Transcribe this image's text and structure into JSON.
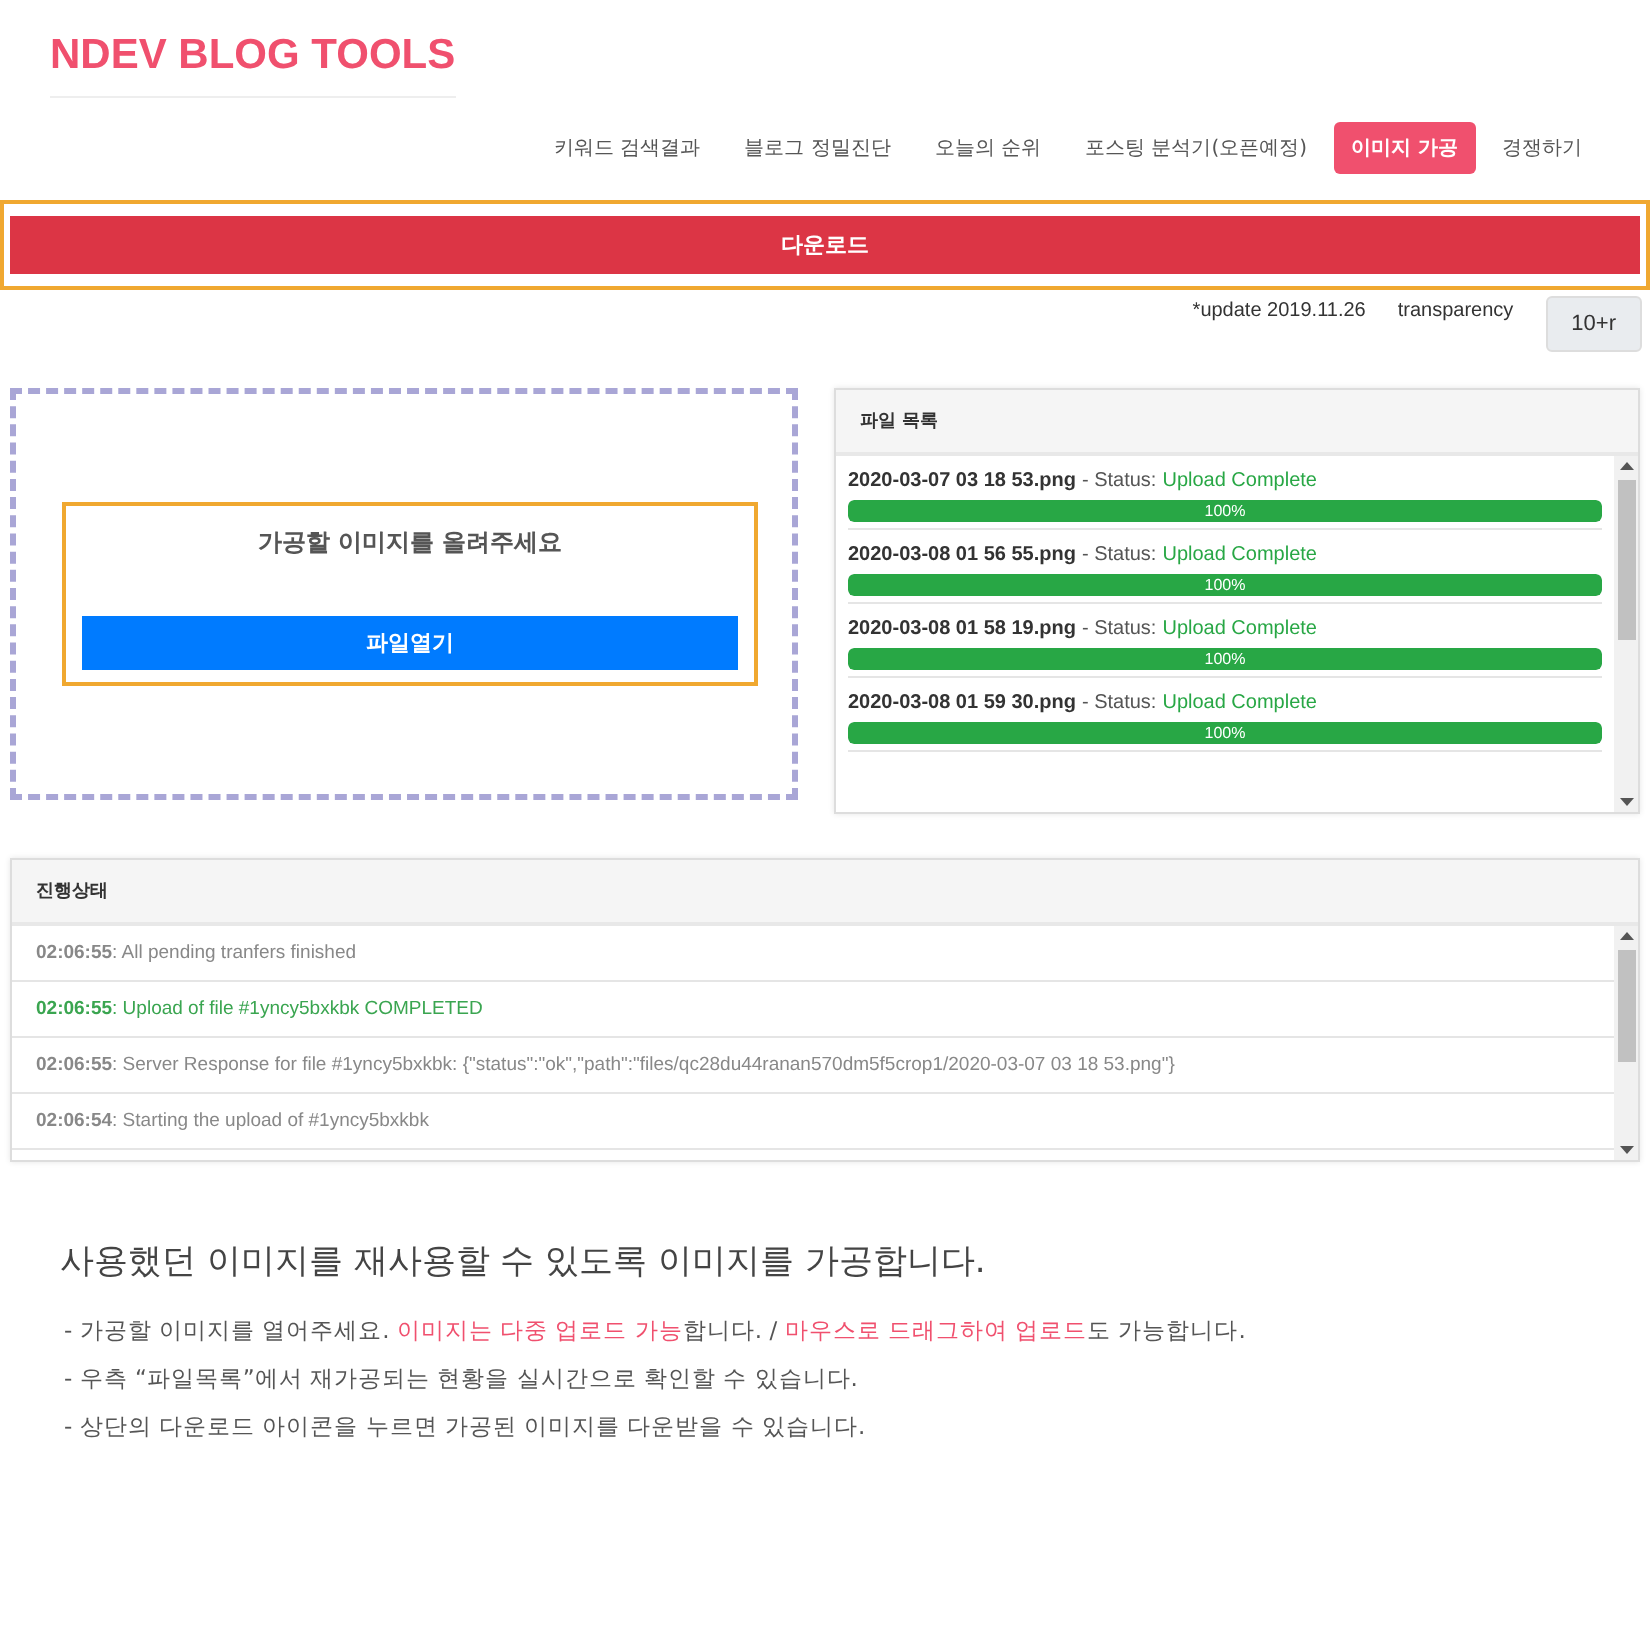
{
  "brand": "NDEV BLOG TOOLS",
  "nav": [
    {
      "label": "키워드 검색결과",
      "selected": false
    },
    {
      "label": "블로그 정밀진단",
      "selected": false
    },
    {
      "label": "오늘의 순위",
      "selected": false
    },
    {
      "label": "포스팅 분석기(오픈예정)",
      "selected": false
    },
    {
      "label": "이미지 가공",
      "selected": true
    },
    {
      "label": "경쟁하기",
      "selected": false
    }
  ],
  "download_button": "다운로드",
  "update_note": "*update 2019.11.26",
  "transparency_label": "transparency",
  "transparency_value": "10+r",
  "dropzone": {
    "prompt": "가공할 이미지를 올려주세요",
    "button": "파일열기"
  },
  "file_list": {
    "title": "파일 목록",
    "files": [
      {
        "name": "2020-03-07 03 18 53.png",
        "status_label": "- Status:",
        "status": "Upload Complete",
        "level": 1,
        "percent": "100%"
      },
      {
        "name": "2020-03-08 01 56 55.png",
        "status_label": "- Status:",
        "status": "Upload Complete",
        "level": 1,
        "percent": "100%"
      },
      {
        "name": "2020-03-08 01 58 19.png",
        "status_label": "- Status:",
        "status": "Upload Complete",
        "level": 1,
        "percent": "100%"
      },
      {
        "name": "2020-03-08 01 59 30.png",
        "status_label": "- Status:",
        "status": "Upload Complete",
        "level": 1,
        "percent": "100%"
      }
    ]
  },
  "progress_log": {
    "title": "진행상태",
    "entries": [
      {
        "time": "02:06:55",
        "message": ": All pending tranfers finished",
        "kind": "info"
      },
      {
        "time": "02:06:55",
        "message": ": Upload of file #1yncy5bxkbk COMPLETED",
        "kind": "success"
      },
      {
        "time": "02:06:55",
        "message": ": Server Response for file #1yncy5bxkbk: {\"status\":\"ok\",\"path\":\"files/qc28du44ranan570dm5f5crop1/2020-03-07 03 18 53.png\"}",
        "kind": "info"
      },
      {
        "time": "02:06:54",
        "message": ": Starting the upload of #1yncy5bxkbk",
        "kind": "info"
      }
    ]
  },
  "description": {
    "heading": "사용했던 이미지를 재사용할 수 있도록 이미지를 가공합니다.",
    "lines": [
      [
        {
          "text": "- 가공할 이미지를 열어주세요. ",
          "highlight": false
        },
        {
          "text": "이미지는 다중 업로드 가능",
          "highlight": true
        },
        {
          "text": "합니다. / ",
          "highlight": false
        },
        {
          "text": "마우스로 드래그하여 업로드",
          "highlight": true
        },
        {
          "text": "도 가능합니다.",
          "highlight": false
        }
      ],
      [
        {
          "text": "- 우측 “파일목록”에서 재가공되는 현황을 실시간으로 확인할 수 있습니다.",
          "highlight": false
        }
      ],
      [
        {
          "text": "- 상단의 다운로드 아이콘을 누르면 가공된 이미지를  다운받을 수 있습니다.",
          "highlight": false
        }
      ]
    ]
  }
}
